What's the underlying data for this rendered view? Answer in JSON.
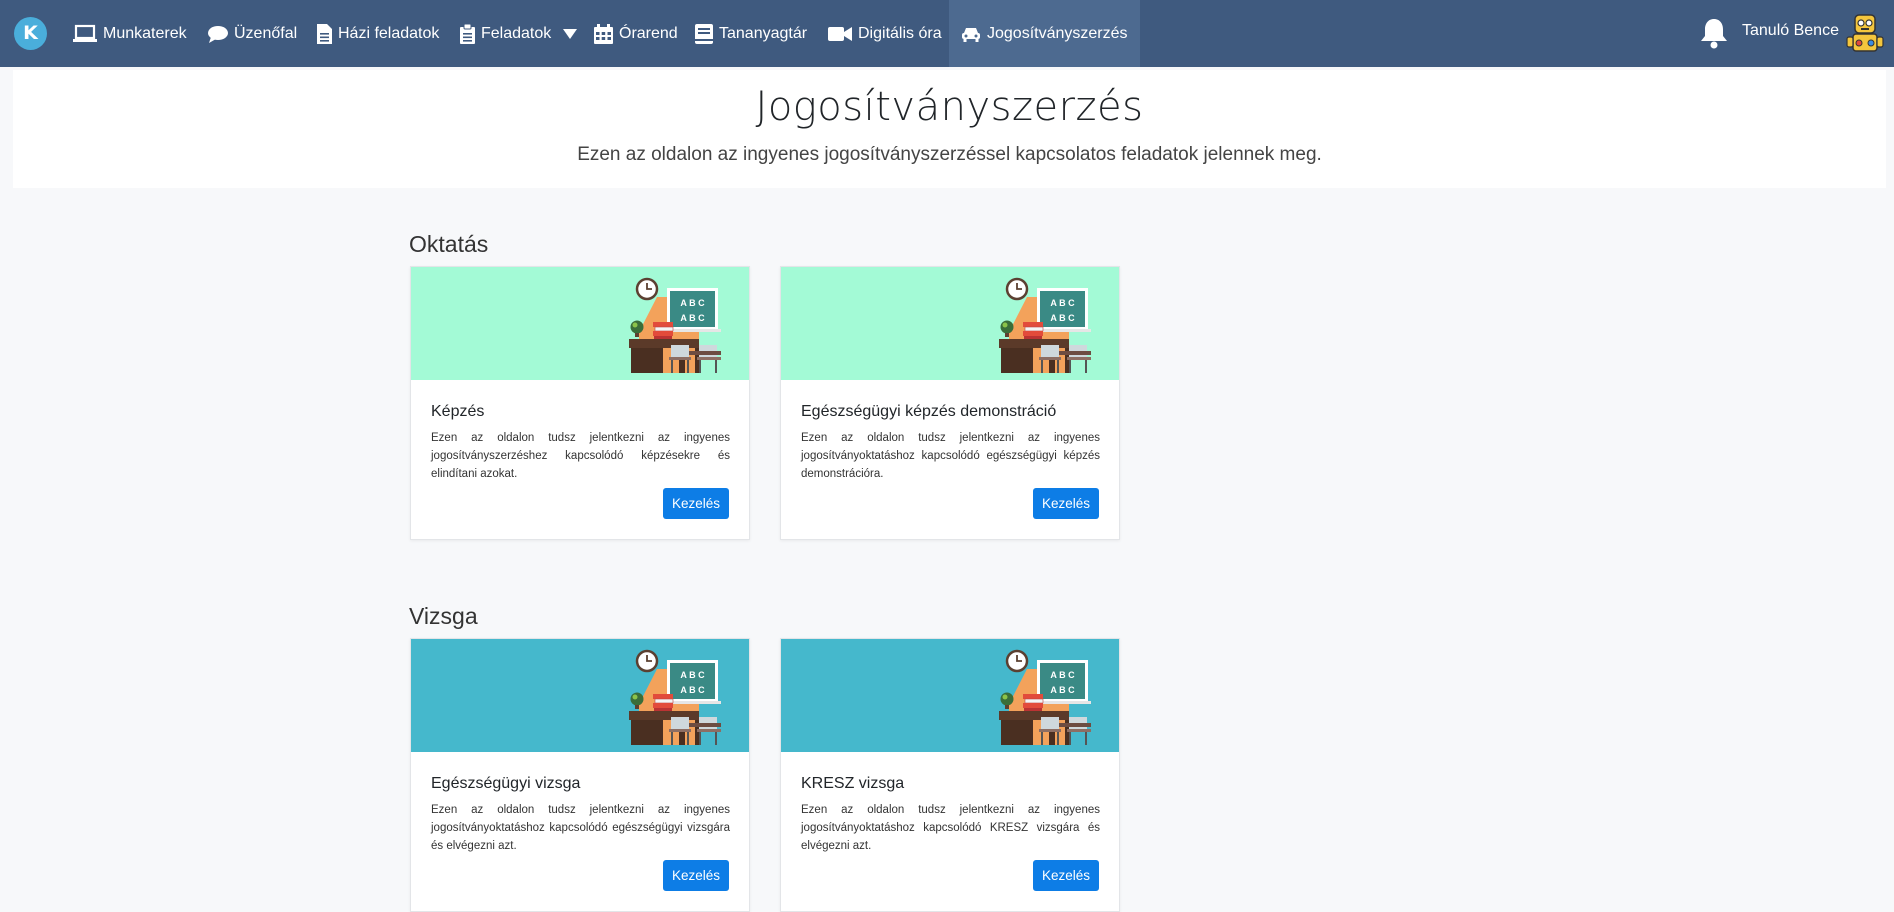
{
  "nav": {
    "logo_letter": "K",
    "items": [
      {
        "label": "Munkaterek",
        "icon": "laptop-icon"
      },
      {
        "label": "Üzenőfal",
        "icon": "chat-bubble-icon"
      },
      {
        "label": "Házi feladatok",
        "icon": "document-icon"
      },
      {
        "label": "Feladatok",
        "icon": "clipboard-icon"
      },
      {
        "label": "Órarend",
        "icon": "calendar-icon"
      },
      {
        "label": "Tananyagtár",
        "icon": "book-icon"
      },
      {
        "label": "Digitális óra",
        "icon": "video-camera-icon"
      },
      {
        "label": "Jogosítványszerzés",
        "icon": "car-icon"
      }
    ],
    "user_name": "Tanuló Bence"
  },
  "hero": {
    "title": "Jogosítványszerzés",
    "subtitle": "Ezen az oldalon az ingyenes jogosítványszerzéssel kapcsolatos feladatok jelennek meg."
  },
  "sections": [
    {
      "title": "Oktatás",
      "color": "#a3fad6",
      "cards": [
        {
          "title": "Képzés",
          "text": "Ezen az oldalon tudsz jelentkezni az ingyenes jogosítványszerzéshez kapcsolódó képzésekre és elindítani azokat.",
          "button": "Kezelés"
        },
        {
          "title": "Egészségügyi képzés demonstráció",
          "text": "Ezen az oldalon tudsz jelentkezni az ingyenes jogosítványoktatáshoz kapcsolódó egészségügyi képzés demonstrációra.",
          "button": "Kezelés"
        }
      ]
    },
    {
      "title": "Vizsga",
      "color": "#45b8cc",
      "cards": [
        {
          "title": "Egészségügyi vizsga",
          "text": "Ezen az oldalon tudsz jelentkezni az ingyenes jogosítványoktatáshoz kapcsolódó egészségügyi vizsgára és elvégezni azt.",
          "button": "Kezelés"
        },
        {
          "title": "KRESZ vizsga",
          "text": "Ezen az oldalon tudsz jelentkezni az ingyenes jogosítványoktatáshoz kapcsolódó KRESZ vizsgára és elvégezni azt.",
          "button": "Kezelés"
        }
      ]
    }
  ],
  "illustration": {
    "board_line_1": "A B C",
    "board_line_2": "A B C"
  }
}
